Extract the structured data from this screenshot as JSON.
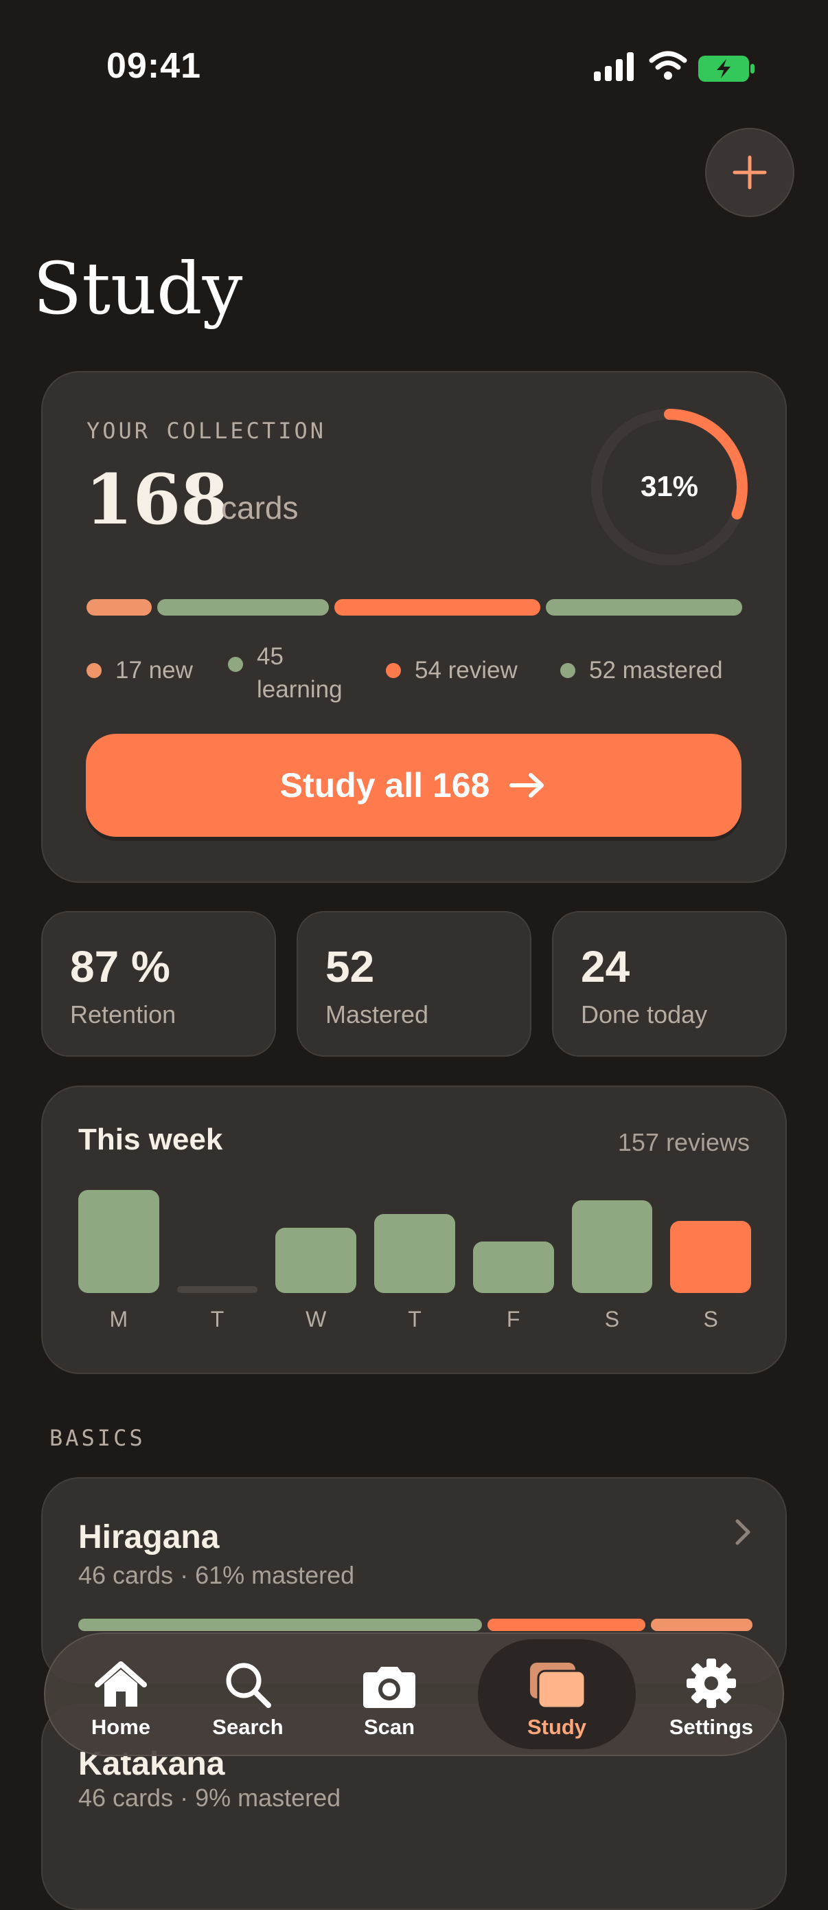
{
  "status_bar": {
    "time": "09:41"
  },
  "header": {
    "title": "Study"
  },
  "collection": {
    "label": "YOUR COLLECTION",
    "count": "168",
    "unit": "cards",
    "progress_percent_text": "31%",
    "progress_fraction": 0.31,
    "legend": [
      {
        "text": "17 new",
        "color": "#f0956a"
      },
      {
        "text": "45\nlearning",
        "color": "#8fa882"
      },
      {
        "text": "54 review",
        "color": "#ff7a4d"
      },
      {
        "text": "52 mastered",
        "color": "#8fa882"
      }
    ],
    "cta_label": "Study all 168"
  },
  "stats": [
    {
      "value": "87 %",
      "label": "Retention"
    },
    {
      "value": "52",
      "label": "Mastered"
    },
    {
      "value": "24",
      "label": "Done today"
    }
  ],
  "week": {
    "title": "This week",
    "total": "157 reviews",
    "days": [
      "M",
      "T",
      "W",
      "T",
      "F",
      "S",
      "S"
    ],
    "values": [
      30,
      0,
      19,
      23,
      15,
      27,
      21
    ]
  },
  "section_label": "BASICS",
  "decks": [
    {
      "name": "Hiragana",
      "meta": "46 cards · 61% mastered"
    },
    {
      "name": "Katakana",
      "meta": "46 cards · 9% mastered"
    }
  ],
  "nav": [
    {
      "label": "Home",
      "icon": "home-icon"
    },
    {
      "label": "Search",
      "icon": "search-icon"
    },
    {
      "label": "Scan",
      "icon": "camera-icon"
    },
    {
      "label": "Study",
      "icon": "cards-icon"
    },
    {
      "label": "Settings",
      "icon": "gear-icon"
    }
  ],
  "colors": {
    "accent": "#ff7a4d",
    "green": "#8fa882",
    "peach": "#f0956a",
    "background": "#1d1917",
    "card": "#34302d"
  }
}
